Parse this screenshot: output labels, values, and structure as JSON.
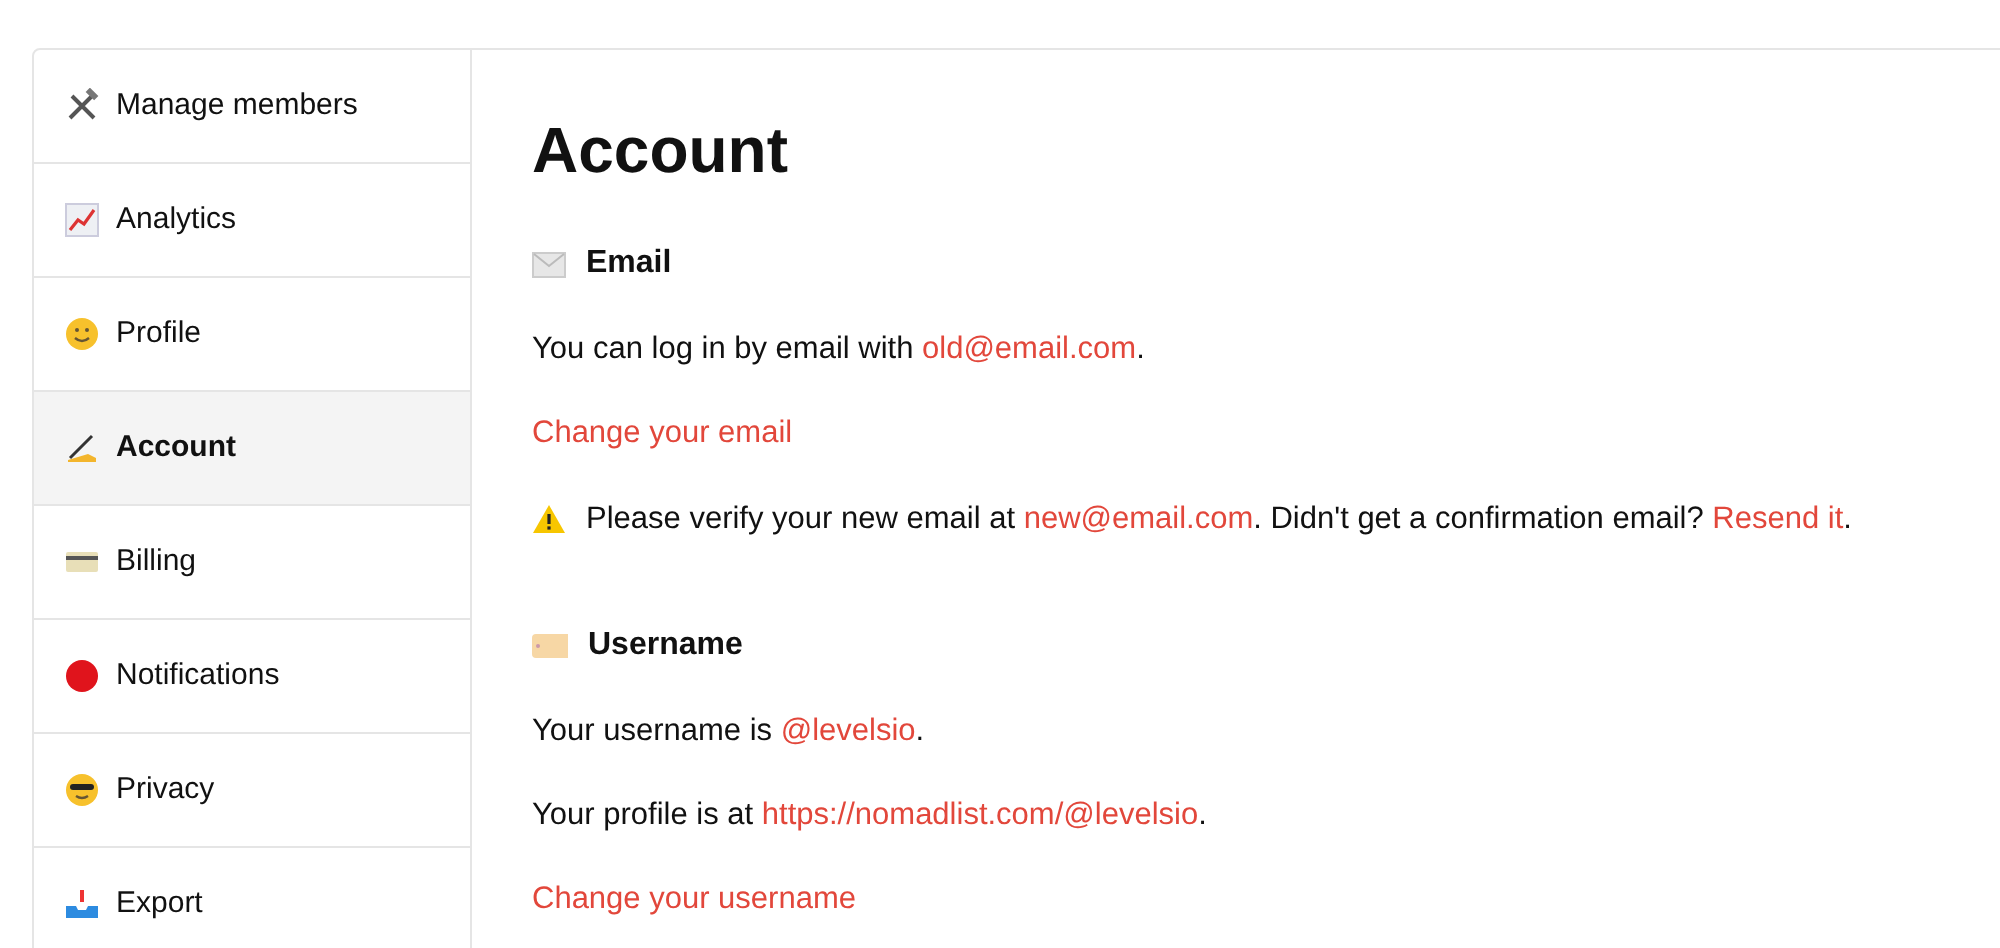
{
  "sidebar": {
    "items": [
      {
        "label": "Manage members",
        "selected": false
      },
      {
        "label": "Analytics",
        "selected": false
      },
      {
        "label": "Profile",
        "selected": false
      },
      {
        "label": "Account",
        "selected": true
      },
      {
        "label": "Billing",
        "selected": false
      },
      {
        "label": "Notifications",
        "selected": false
      },
      {
        "label": "Privacy",
        "selected": false
      },
      {
        "label": "Export",
        "selected": false
      }
    ]
  },
  "page_title": "Account",
  "sections": [
    {
      "heading": "Email",
      "lines": [
        {
          "kind": "sentence",
          "parts": [
            {
              "kind": "text",
              "text": "You can log in by email with "
            },
            {
              "kind": "link",
              "text": "old@email.com"
            },
            {
              "kind": "text",
              "text": "."
            }
          ]
        },
        {
          "kind": "link",
          "text": "Change your email"
        },
        {
          "kind": "warning",
          "parts": [
            {
              "kind": "text",
              "text": "Please verify your new email at "
            },
            {
              "kind": "link",
              "text": "new@email.com"
            },
            {
              "kind": "text",
              "text": ". Didn't get a confirmation email? "
            },
            {
              "kind": "link",
              "text": "Resend it"
            },
            {
              "kind": "text",
              "text": "."
            }
          ]
        }
      ]
    },
    {
      "heading": "Username",
      "lines": [
        {
          "kind": "sentence",
          "parts": [
            {
              "kind": "text",
              "text": "Your username is "
            },
            {
              "kind": "link",
              "text": "@levelsio"
            },
            {
              "kind": "text",
              "text": "."
            }
          ]
        },
        {
          "kind": "sentence",
          "parts": [
            {
              "kind": "text",
              "text": "Your profile is at "
            },
            {
              "kind": "link",
              "text": "https://nomadlist.com/@levelsio"
            },
            {
              "kind": "text",
              "text": "."
            }
          ]
        },
        {
          "kind": "link",
          "text": "Change your username"
        }
      ]
    }
  ]
}
